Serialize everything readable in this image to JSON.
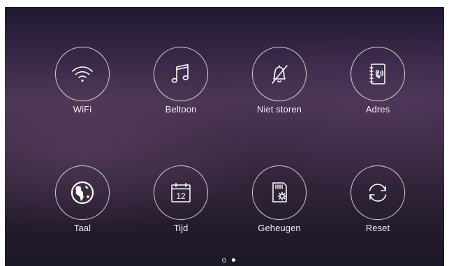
{
  "menu": {
    "items": [
      {
        "label": "WiFi",
        "icon": "wifi-icon"
      },
      {
        "label": "Beltoon",
        "icon": "music-note-icon"
      },
      {
        "label": "Niet storen",
        "icon": "bell-muted-icon"
      },
      {
        "label": "Adres",
        "icon": "address-book-icon"
      },
      {
        "label": "Taal",
        "icon": "globe-icon"
      },
      {
        "label": "Tijd",
        "icon": "calendar-icon"
      },
      {
        "label": "Geheugen",
        "icon": "sd-card-settings-icon"
      },
      {
        "label": "Reset",
        "icon": "refresh-icon"
      }
    ]
  },
  "pagination": {
    "pages": 2,
    "current_page": 2
  },
  "colors": {
    "background_top": "#1f1832",
    "background_mid": "#4a3452",
    "background_bottom": "#1c1724",
    "foreground": "#ffffff"
  }
}
